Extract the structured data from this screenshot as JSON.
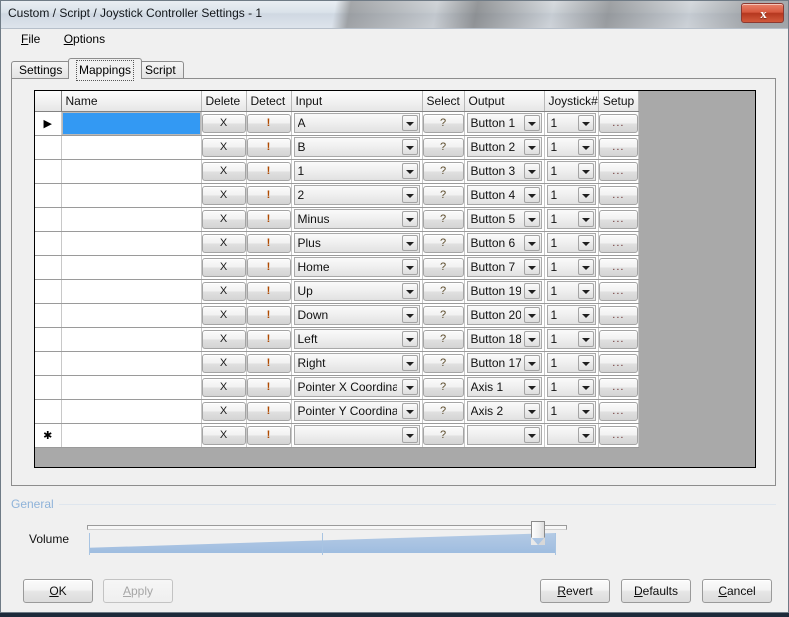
{
  "window": {
    "title": "Custom / Script / Joystick Controller Settings - 1",
    "close_label": "x",
    "close_icon": "close-icon"
  },
  "menubar": {
    "items": [
      {
        "label": "File",
        "mnemonic": "F"
      },
      {
        "label": "Options",
        "mnemonic": "O"
      }
    ]
  },
  "tabs": [
    {
      "label": "Settings",
      "active": false
    },
    {
      "label": "Mappings",
      "active": true
    },
    {
      "label": "Script",
      "active": false
    }
  ],
  "grid": {
    "headers": [
      "",
      "Name",
      "Delete",
      "Detect",
      "Input",
      "Select",
      "Output",
      "Joystick#",
      "Setup"
    ],
    "row_marker_current": "▶",
    "row_marker_new": "✱",
    "delete_label": "X",
    "detect_label": "!",
    "select_label": "?",
    "setup_label": "...",
    "selection_color": "#3399f3",
    "filler_color": "#a9a9a9",
    "rows": [
      {
        "marker": "current",
        "name": "",
        "input": "A",
        "output": "Button 1",
        "joystick": "1"
      },
      {
        "marker": "",
        "name": "",
        "input": "B",
        "output": "Button 2",
        "joystick": "1"
      },
      {
        "marker": "",
        "name": "",
        "input": "1",
        "output": "Button 3",
        "joystick": "1"
      },
      {
        "marker": "",
        "name": "",
        "input": "2",
        "output": "Button 4",
        "joystick": "1"
      },
      {
        "marker": "",
        "name": "",
        "input": "Minus",
        "output": "Button 5",
        "joystick": "1"
      },
      {
        "marker": "",
        "name": "",
        "input": "Plus",
        "output": "Button 6",
        "joystick": "1"
      },
      {
        "marker": "",
        "name": "",
        "input": "Home",
        "output": "Button 7",
        "joystick": "1"
      },
      {
        "marker": "",
        "name": "",
        "input": "Up",
        "output": "Button 19",
        "joystick": "1"
      },
      {
        "marker": "",
        "name": "",
        "input": "Down",
        "output": "Button 20",
        "joystick": "1"
      },
      {
        "marker": "",
        "name": "",
        "input": "Left",
        "output": "Button 18",
        "joystick": "1"
      },
      {
        "marker": "",
        "name": "",
        "input": "Right",
        "output": "Button 17",
        "joystick": "1"
      },
      {
        "marker": "",
        "name": "",
        "input": "Pointer X Coordinate",
        "output": "Axis 1",
        "joystick": "1"
      },
      {
        "marker": "",
        "name": "",
        "input": "Pointer Y Coordinate",
        "output": "Axis 2",
        "joystick": "1"
      },
      {
        "marker": "new",
        "name": "",
        "input": "",
        "output": "",
        "joystick": ""
      }
    ]
  },
  "general": {
    "section_label": "General",
    "volume_label": "Volume",
    "volume_value": 96
  },
  "footer": {
    "ok": "OK",
    "ok_mnemonic": "O",
    "apply": "Apply",
    "apply_mnemonic": "A",
    "apply_enabled": false,
    "revert": "Revert",
    "revert_mnemonic": "R",
    "defaults": "Defaults",
    "defaults_mnemonic": "D",
    "cancel": "Cancel",
    "cancel_mnemonic": "C"
  }
}
